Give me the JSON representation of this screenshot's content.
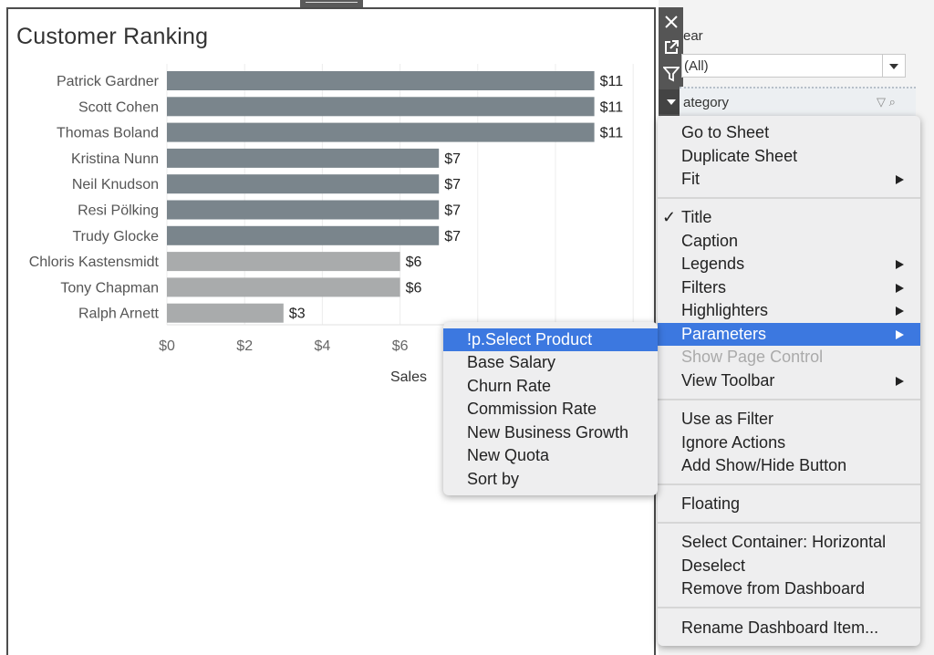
{
  "sheet": {
    "title": "Customer Ranking"
  },
  "chart_data": {
    "type": "bar",
    "orientation": "horizontal",
    "title": "Customer Ranking",
    "xlabel": "Sales",
    "ylabel": "",
    "xlim": [
      0,
      12
    ],
    "x_ticks": [
      "$0",
      "$2",
      "$4",
      "$6"
    ],
    "grid": true,
    "categories": [
      "Patrick Gardner",
      "Scott Cohen",
      "Thomas Boland",
      "Kristina Nunn",
      "Neil Knudson",
      "Resi Pölking",
      "Trudy Glocke",
      "Chloris Kastensmidt",
      "Tony Chapman",
      "Ralph Arnett"
    ],
    "values": [
      11,
      11,
      11,
      7,
      7,
      7,
      7,
      6,
      6,
      3
    ],
    "value_labels": [
      "$11",
      "$11",
      "$11",
      "$7",
      "$7",
      "$7",
      "$7",
      "$6",
      "$6",
      "$3"
    ],
    "bar_colors": [
      "#7a858c",
      "#7a858c",
      "#7a858c",
      "#7a858c",
      "#7a858c",
      "#7a858c",
      "#7a858c",
      "#a9abac",
      "#a9abac",
      "#a9abac"
    ]
  },
  "toolbar": {
    "close_icon": "close-icon",
    "open_icon": "open-external-icon",
    "filter_icon": "filter-icon",
    "more_icon": "dropdown-arrow-icon"
  },
  "filters": {
    "year_label": "ear",
    "year_value": "(All)",
    "category_label": "ategory"
  },
  "main_menu": {
    "items": [
      {
        "label": "Go to Sheet"
      },
      {
        "label": "Duplicate Sheet"
      },
      {
        "label": "Fit"
      },
      {
        "label": "Title",
        "check": "✓"
      },
      {
        "label": "Caption"
      },
      {
        "label": "Legends"
      },
      {
        "label": "Filters"
      },
      {
        "label": "Highlighters"
      },
      {
        "label": "Parameters"
      },
      {
        "label": "Show Page Control"
      },
      {
        "label": "View Toolbar"
      },
      {
        "label": "Use as Filter"
      },
      {
        "label": "Ignore Actions"
      },
      {
        "label": "Add Show/Hide Button"
      },
      {
        "label": "Floating"
      },
      {
        "label": "Select Container: Horizontal"
      },
      {
        "label": "Deselect"
      },
      {
        "label": "Remove from Dashboard"
      },
      {
        "label": "Rename Dashboard Item..."
      }
    ]
  },
  "parameters_menu": {
    "items": [
      {
        "label": "!p.Select Product"
      },
      {
        "label": "Base Salary"
      },
      {
        "label": "Churn Rate"
      },
      {
        "label": "Commission Rate"
      },
      {
        "label": "New Business Growth"
      },
      {
        "label": "New Quota"
      },
      {
        "label": "Sort by"
      }
    ]
  },
  "colors": {
    "highlight": "#3c78e0",
    "bar_dark": "#7a858c",
    "bar_light": "#a9abac"
  }
}
